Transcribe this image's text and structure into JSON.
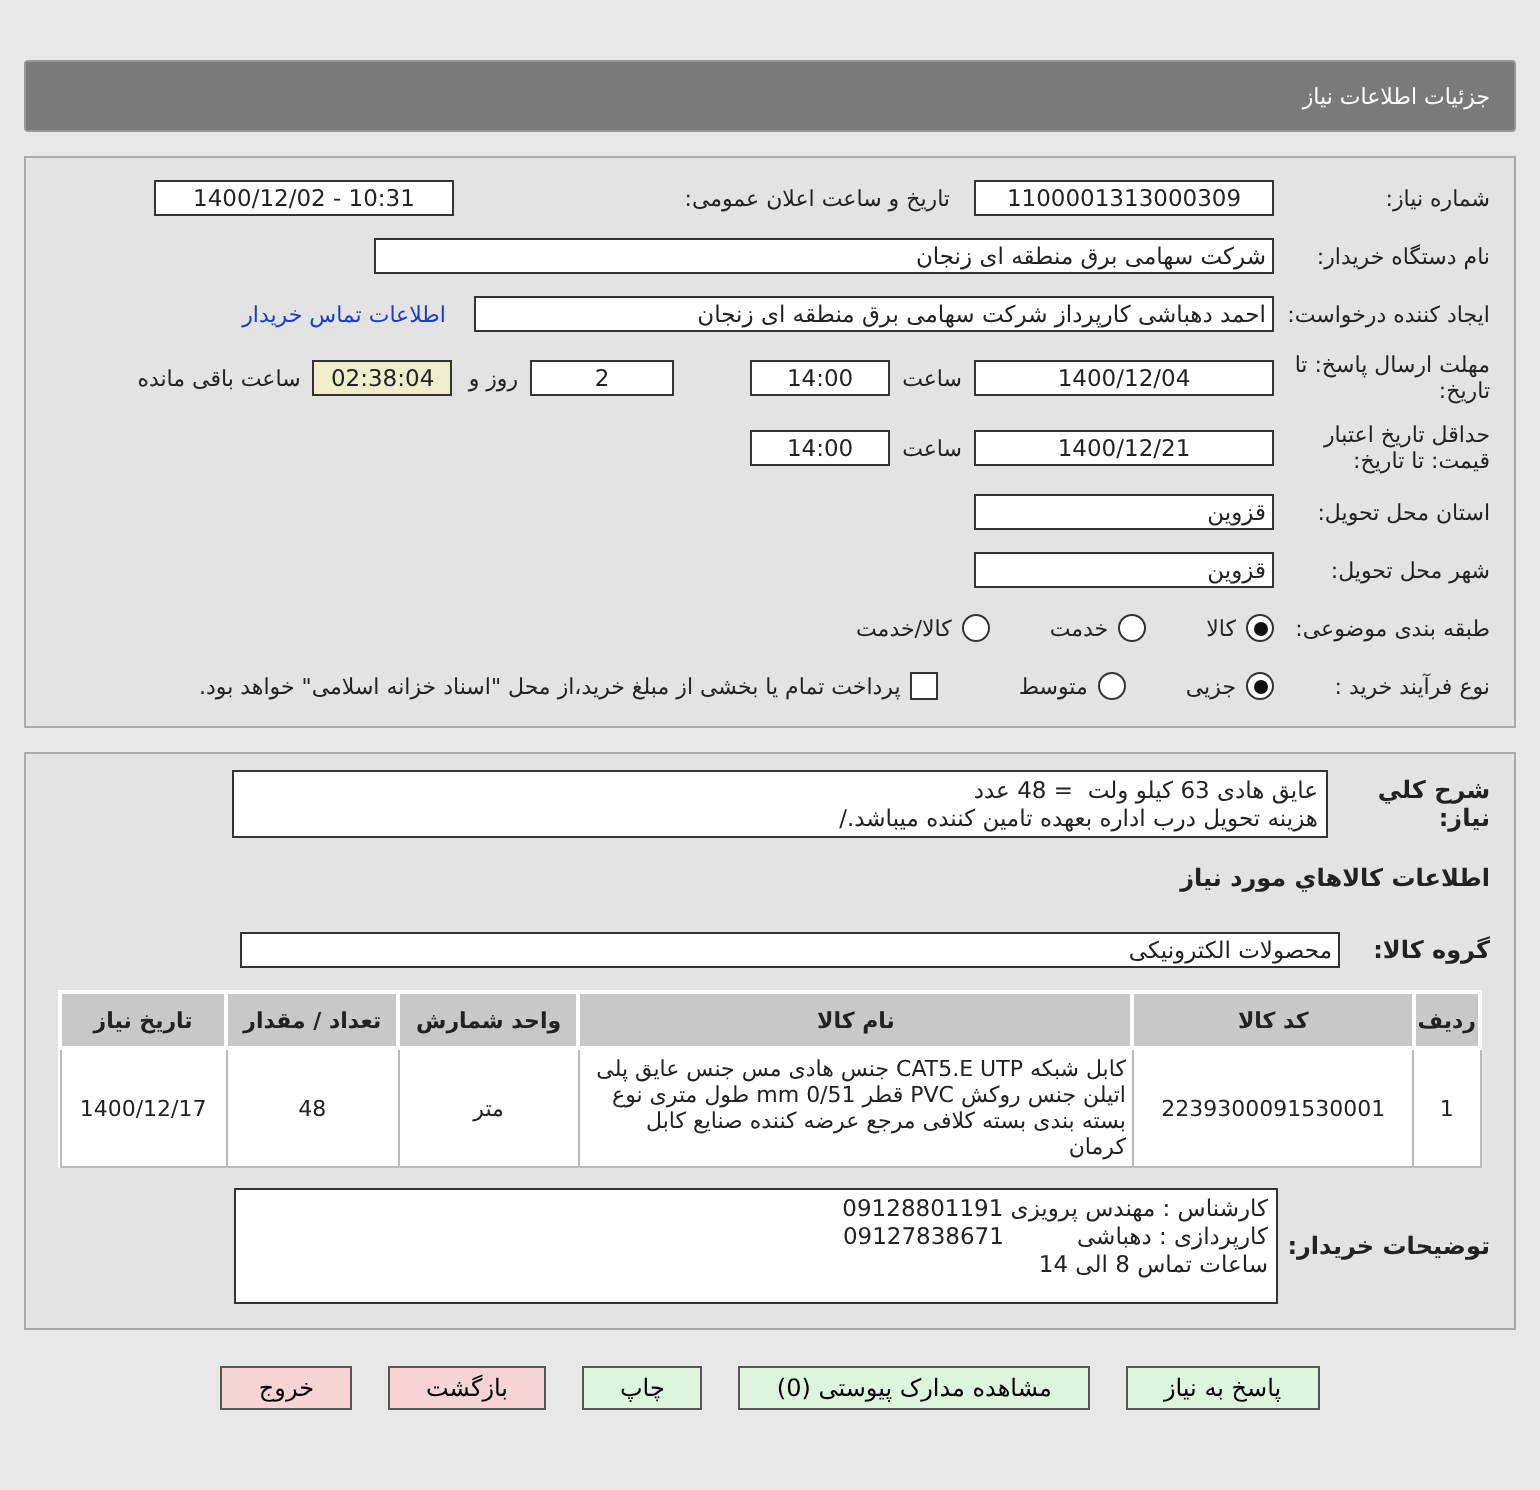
{
  "header": {
    "title": "جزئیات اطلاعات نیاز"
  },
  "form": {
    "need_number": {
      "label": "شماره نیاز:",
      "value": "1100001313000309"
    },
    "announce": {
      "label": "تاریخ و ساعت اعلان عمومی:",
      "value": "1400/12/02 - 10:31"
    },
    "buyer_org": {
      "label": "نام دستگاه خریدار:",
      "value": "شرکت سهامی برق منطقه ای زنجان"
    },
    "requester": {
      "label": "ایجاد کننده درخواست:",
      "value": "احمد دهباشی کارپرداز شرکت سهامی برق منطقه ای زنجان",
      "link": "اطلاعات تماس خریدار"
    },
    "deadline": {
      "label": "مهلت ارسال پاسخ: تا تاریخ:",
      "date": "1400/12/04",
      "time_label": "ساعت",
      "time": "14:00",
      "days": "2",
      "days_label": "روز و",
      "remaining": "02:38:04",
      "remaining_label": "ساعت باقی مانده"
    },
    "validity": {
      "label": "حداقل تاریخ اعتبار قیمت: تا تاریخ:",
      "date": "1400/12/21",
      "time_label": "ساعت",
      "time": "14:00"
    },
    "province": {
      "label": "استان محل تحویل:",
      "value": "قزوین"
    },
    "city": {
      "label": "شهر محل تحویل:",
      "value": "قزوین"
    },
    "category": {
      "label": "طبقه بندی موضوعی:",
      "options": [
        {
          "label": "کالا",
          "selected": true
        },
        {
          "label": "خدمت",
          "selected": false
        },
        {
          "label": "کالا/خدمت",
          "selected": false
        }
      ]
    },
    "process": {
      "label": "نوع فرآیند خرید :",
      "options": [
        {
          "label": "جزیی",
          "selected": true
        },
        {
          "label": "متوسط",
          "selected": false
        }
      ],
      "payment": {
        "checked": false,
        "text": "پرداخت تمام یا بخشی از مبلغ خرید،از محل \"اسناد خزانه اسلامی\" خواهد بود."
      }
    }
  },
  "description": {
    "label": "شرح کلي نياز:",
    "lines": [
      "عایق هادی 63 کیلو ولت  = 48 عدد",
      "هزینه تحویل درب اداره بعهده تامین کننده میباشد./"
    ]
  },
  "goods_title": "اطلاعات کالاهاي مورد نياز",
  "group": {
    "label": "گروه کالا:",
    "value": "محصولات الکترونیکی"
  },
  "table": {
    "columns": [
      "ردیف",
      "کد کالا",
      "نام کالا",
      "واحد شمارش",
      "تعداد / مقدار",
      "تاریخ نیاز"
    ],
    "rows": [
      [
        "1",
        "2239300091530001",
        "کابل شبکه CAT5.E UTP جنس هادی مس جنس عایق پلی اتیلن جنس روکش PVC قطر 0/51 mm طول متری نوع بسته بندی بسته کلافی مرجع عرضه کننده صنایع کابل کرمان",
        "متر",
        "48",
        "1400/12/17"
      ]
    ]
  },
  "notes": {
    "label": "توضیحات خریدار:",
    "lines": [
      "کارشناس : مهندس پرویزی 09128801191",
      "کارپردازی : دهباشی          09127838671",
      "ساعات تماس 8 الی 14"
    ]
  },
  "buttons": [
    {
      "label": "پاسخ به نیاز",
      "kind": "normal"
    },
    {
      "label": "مشاهده مدارک پیوستی (0)",
      "kind": "normal"
    },
    {
      "label": "چاپ",
      "kind": "normal"
    },
    {
      "label": "بازگشت",
      "kind": "danger"
    },
    {
      "label": "خروج",
      "kind": "danger"
    }
  ]
}
